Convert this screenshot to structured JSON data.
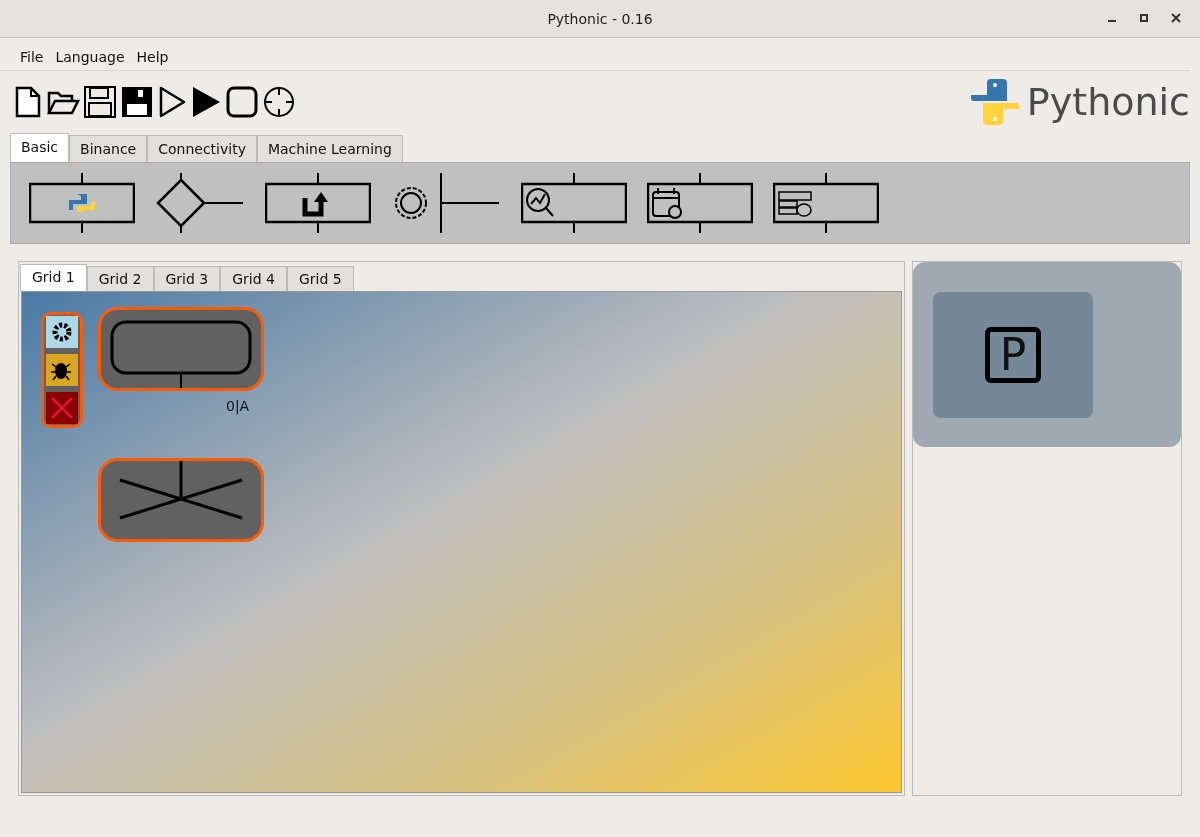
{
  "window": {
    "title": "Pythonic - 0.16"
  },
  "menu": [
    "File",
    "Language",
    "Help"
  ],
  "logo": {
    "text": "Pythonic"
  },
  "tabs": [
    {
      "label": "Basic",
      "selected": true
    },
    {
      "label": "Binance",
      "selected": false
    },
    {
      "label": "Connectivity",
      "selected": false
    },
    {
      "label": "Machine Learning",
      "selected": false
    }
  ],
  "grid_tabs": [
    {
      "label": "Grid 1",
      "selected": true
    },
    {
      "label": "Grid 2",
      "selected": false
    },
    {
      "label": "Grid 3",
      "selected": false
    },
    {
      "label": "Grid 4",
      "selected": false
    },
    {
      "label": "Grid 5",
      "selected": false
    }
  ],
  "canvas": {
    "element_label": "0|A"
  },
  "side_panel": {
    "symbol": "P"
  }
}
